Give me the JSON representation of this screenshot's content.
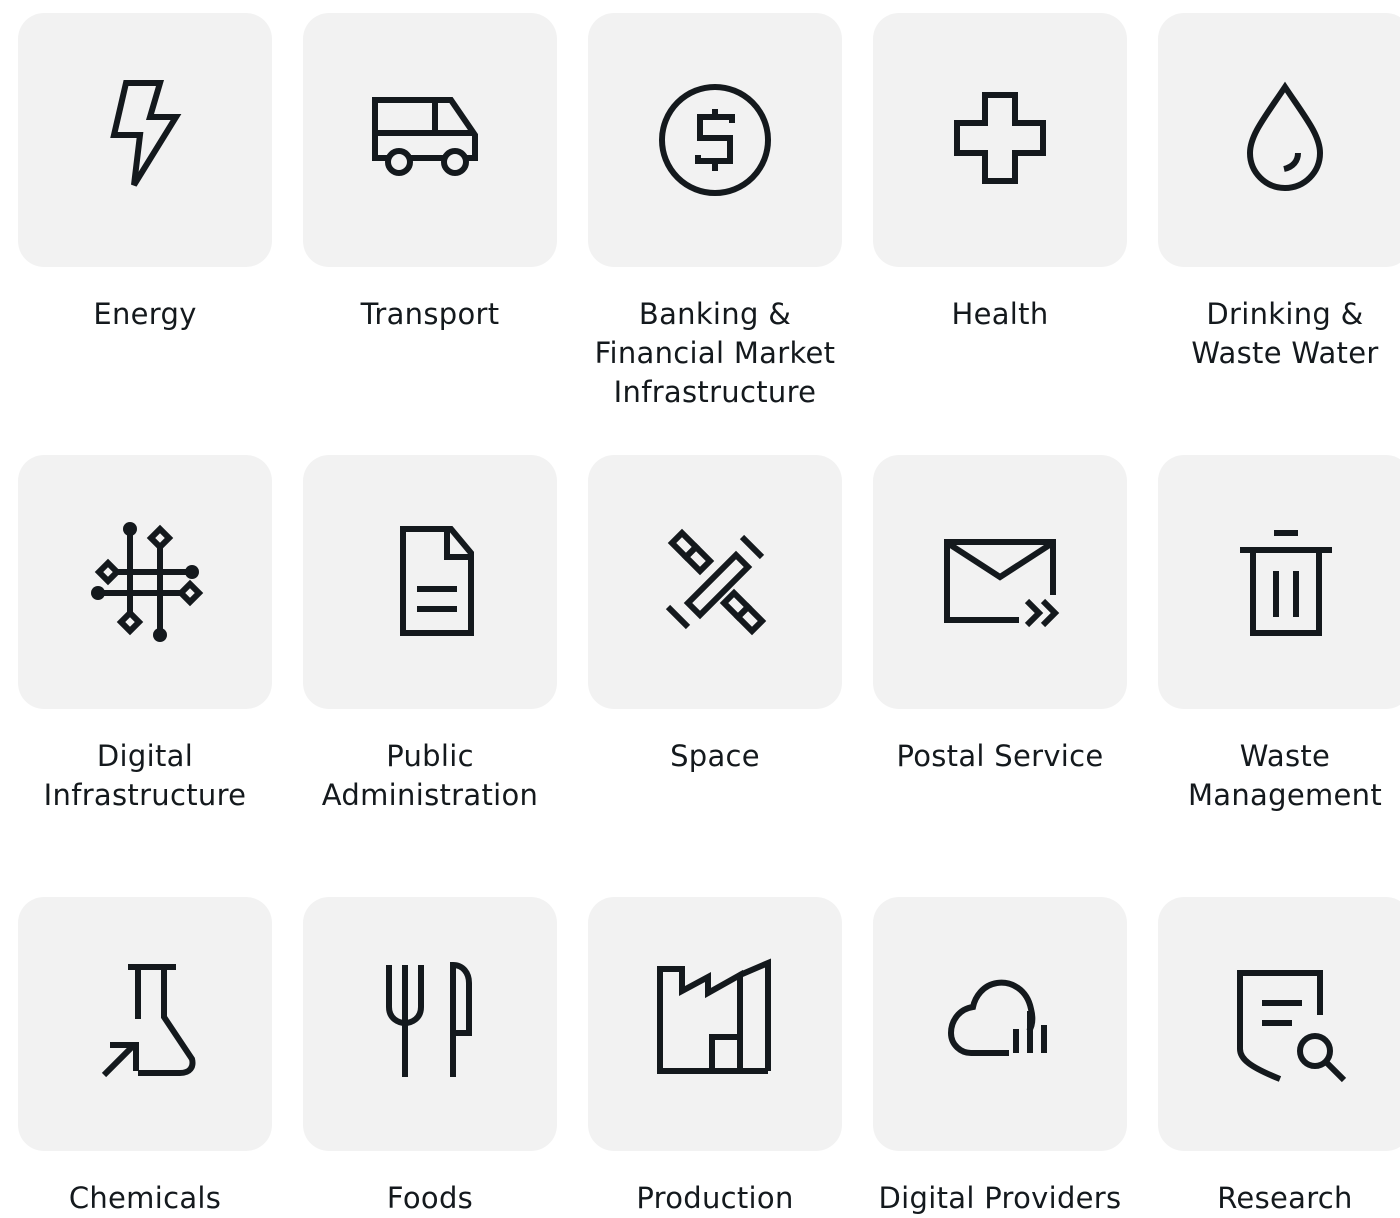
{
  "colors": {
    "tile_background": "#f2f2f2",
    "icon_stroke": "#14191d",
    "text": "#14191d",
    "page_background": "#ffffff"
  },
  "sectors": [
    {
      "label": "Energy",
      "icon": "lightning-bolt-icon"
    },
    {
      "label": "Transport",
      "icon": "van-icon"
    },
    {
      "label": "Banking &\nFinancial Market\nInfrastructure",
      "icon": "dollar-coin-icon"
    },
    {
      "label": "Health",
      "icon": "medical-cross-icon"
    },
    {
      "label": "Drinking &\nWaste Water",
      "icon": "water-drop-icon"
    },
    {
      "label": "Digital\nInfrastructure",
      "icon": "circuit-icon"
    },
    {
      "label": "Public\nAdministration",
      "icon": "document-icon"
    },
    {
      "label": "Space",
      "icon": "satellite-icon"
    },
    {
      "label": "Postal Service",
      "icon": "envelope-forward-icon"
    },
    {
      "label": "Waste\nManagement",
      "icon": "trash-can-icon"
    },
    {
      "label": "Chemicals",
      "icon": "flask-icon"
    },
    {
      "label": "Foods",
      "icon": "fork-knife-icon"
    },
    {
      "label": "Production",
      "icon": "factory-icon"
    },
    {
      "label": "Digital Providers",
      "icon": "cloud-chart-icon"
    },
    {
      "label": "Research",
      "icon": "document-search-icon"
    }
  ]
}
